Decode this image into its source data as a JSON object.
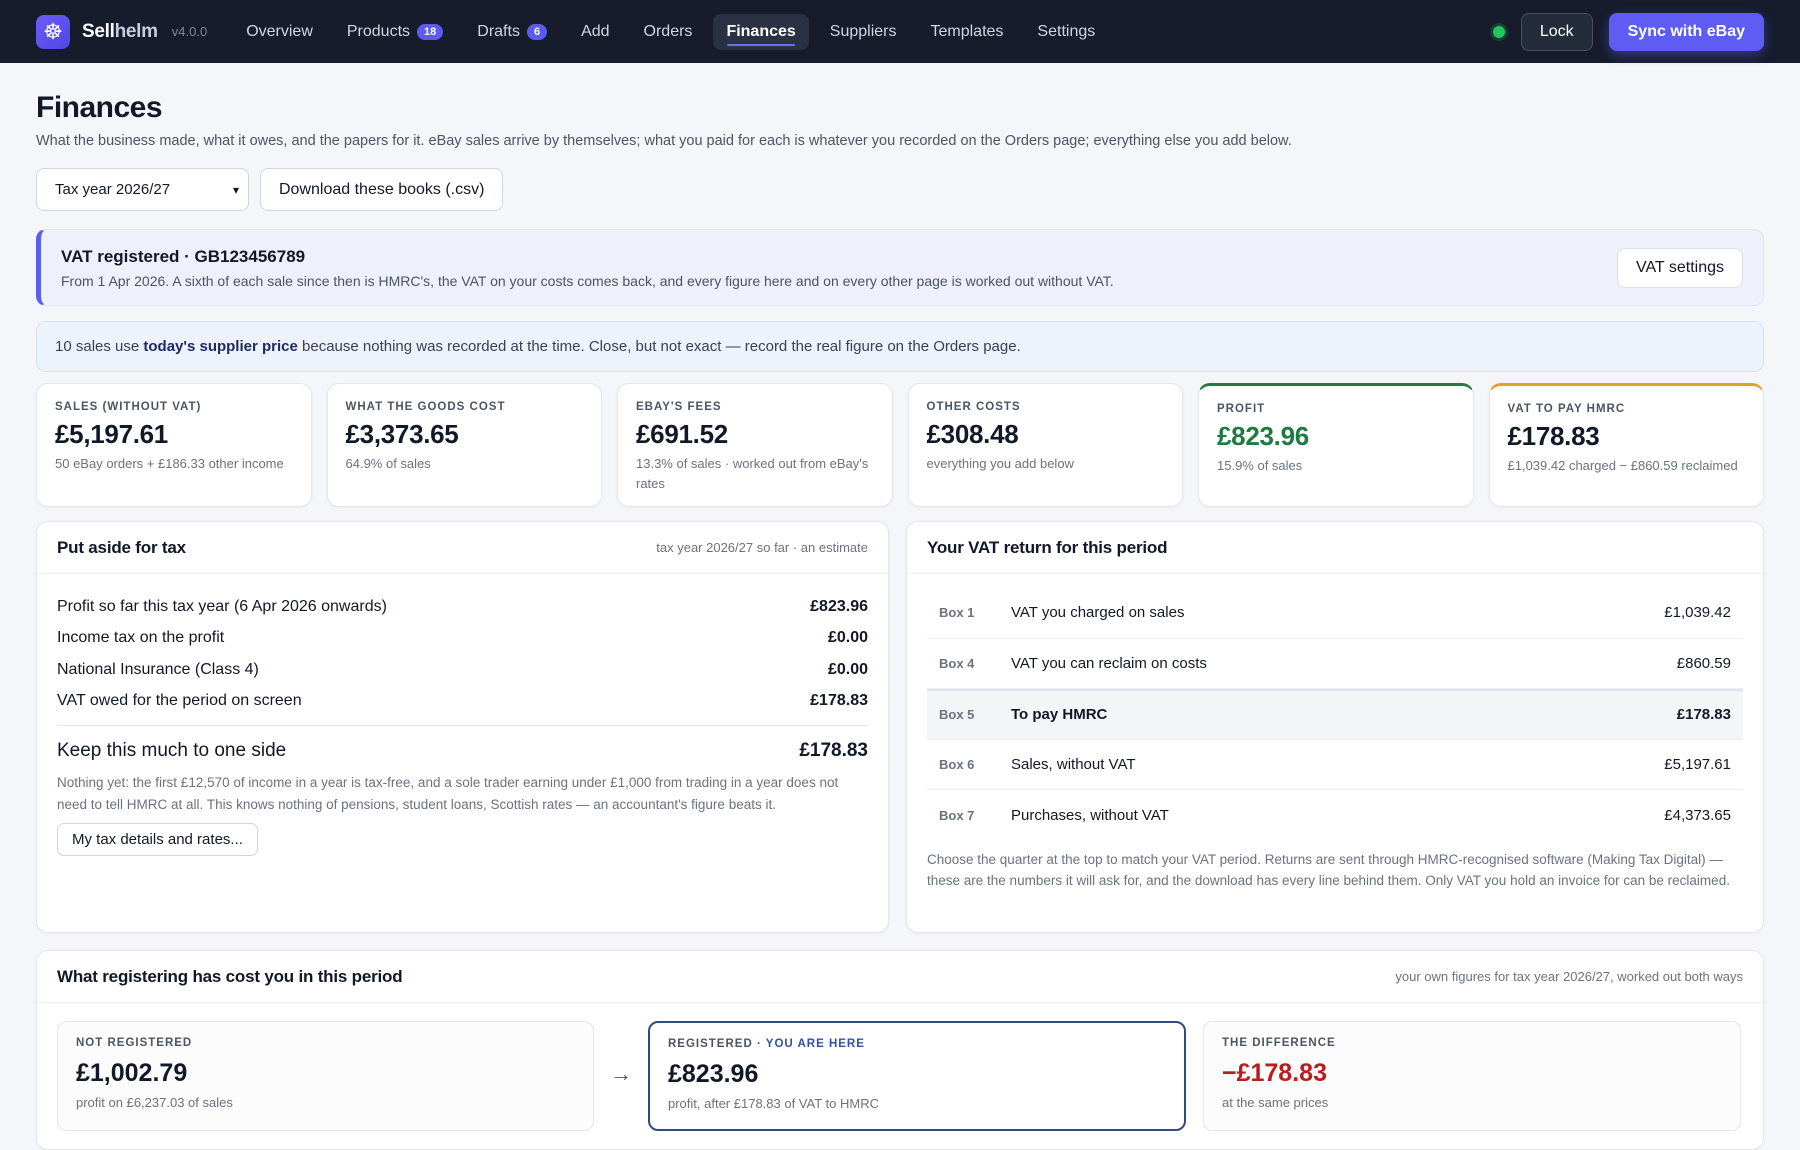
{
  "app": {
    "name_main": "Sell",
    "name_rest": "helm",
    "version": "v4.0.0",
    "logo_icon": "ship-wheel-icon",
    "accent": "#5e5cf2"
  },
  "nav": [
    {
      "label": "Overview"
    },
    {
      "label": "Products",
      "badge": "18"
    },
    {
      "label": "Drafts",
      "badge": "6"
    },
    {
      "label": "Add"
    },
    {
      "label": "Orders"
    },
    {
      "label": "Finances",
      "active": true
    },
    {
      "label": "Suppliers"
    },
    {
      "label": "Templates"
    },
    {
      "label": "Settings"
    }
  ],
  "top_actions": {
    "lock_label": "Lock",
    "sync_label": "Sync with eBay",
    "status_color": "#22c55e"
  },
  "page": {
    "title": "Finances",
    "subtitle": "What the business made, what it owes, and the papers for it. eBay sales arrive by themselves; what you paid for each is whatever you recorded on the Orders page; everything else you add below.",
    "period_select": "Tax year 2026/27",
    "download_label": "Download these books (.csv)"
  },
  "vat_banner": {
    "title": "VAT registered · GB123456789",
    "desc": "From 1 Apr 2026. A sixth of each sale since then is HMRC's, the VAT on your costs comes back, and every figure here and on every other page is worked out without VAT.",
    "button": "VAT settings"
  },
  "notice": {
    "before": "10 sales use ",
    "bold": "today's supplier price",
    "after": " because nothing was recorded at the time. Close, but not exact — record the real figure on the Orders page."
  },
  "stats": [
    {
      "label": "Sales (without VAT)",
      "value": "£5,197.61",
      "sub": "50 eBay orders + £186.33 other income"
    },
    {
      "label": "What the goods cost",
      "value": "£3,373.65",
      "sub": "64.9% of sales"
    },
    {
      "label": "eBay's fees",
      "value": "£691.52",
      "sub": "13.3% of sales · worked out from eBay's rates"
    },
    {
      "label": "Other costs",
      "value": "£308.48",
      "sub": "everything you add below"
    },
    {
      "label": "Profit",
      "value": "£823.96",
      "sub": "15.9% of sales"
    },
    {
      "label": "VAT to pay HMRC",
      "value": "£178.83",
      "sub": "£1,039.42 charged − £860.59 reclaimed"
    }
  ],
  "tax": {
    "title": "Put aside for tax",
    "note": "tax year 2026/27 so far · an estimate",
    "rows": [
      {
        "label": "Profit so far this tax year (6 Apr 2026 onwards)",
        "value": "£823.96"
      },
      {
        "label": "Income tax on the profit",
        "value": "£0.00"
      },
      {
        "label": "National Insurance (Class 4)",
        "value": "£0.00"
      },
      {
        "label": "VAT owed for the period on screen",
        "value": "£178.83"
      }
    ],
    "keep_label": "Keep this much to one side",
    "keep_value": "£178.83",
    "explain": "Nothing yet: the first £12,570 of income in a year is tax-free, and a sole trader earning under £1,000 from trading in a year does not need to tell HMRC at all. This knows nothing of pensions, student loans, Scottish rates — an accountant's figure beats it.",
    "button": "My tax details and rates..."
  },
  "vat_return": {
    "title": "Your VAT return for this period",
    "rows": [
      {
        "box": "Box 1",
        "label": "VAT you charged on sales",
        "value": "£1,039.42"
      },
      {
        "box": "Box 4",
        "label": "VAT you can reclaim on costs",
        "value": "£860.59"
      },
      {
        "box": "Box 5",
        "label": "To pay HMRC",
        "value": "£178.83"
      },
      {
        "box": "Box 6",
        "label": "Sales, without VAT",
        "value": "£5,197.61"
      },
      {
        "box": "Box 7",
        "label": "Purchases, without VAT",
        "value": "£4,373.65"
      }
    ],
    "note": "Choose the quarter at the top to match your VAT period. Returns are sent through HMRC-recognised software (Making Tax Digital) — these are the numbers it will ask for, and the download has every line behind them. Only VAT you hold an invoice for can be reclaimed."
  },
  "registering": {
    "title": "What registering has cost you in this period",
    "note": "your own figures for tax year 2026/27, worked out both ways",
    "not_registered": {
      "label": "Not registered",
      "value": "£1,002.79",
      "sub": "profit on £6,237.03 of sales"
    },
    "arrow": "→",
    "registered": {
      "label": "Registered · ",
      "tag": "You are here",
      "value": "£823.96",
      "sub": "profit, after £178.83 of VAT to HMRC"
    },
    "difference": {
      "label": "The difference",
      "value": "−£178.83",
      "sub": "at the same prices",
      "color": "#b91c1c"
    }
  }
}
